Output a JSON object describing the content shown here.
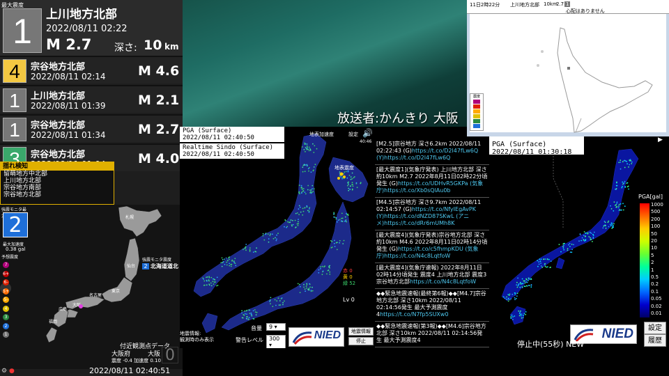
{
  "main_quake": {
    "header": "最大震度",
    "intensity": "1",
    "region": "上川地方北部",
    "time": "2022/08/11  02:22",
    "magnitude": "M 2.7",
    "depth_label": "深さ:",
    "depth_value": "10",
    "depth_unit": "km"
  },
  "history": [
    {
      "intensity": "4",
      "region": "宗谷地方北部",
      "time": "2022/08/11  02:14",
      "magnitude": "M 4.6",
      "color": "#f3c842",
      "text_color": "#000"
    },
    {
      "intensity": "1",
      "region": "上川地方北部",
      "time": "2022/08/11  01:39",
      "magnitude": "M 2.1",
      "color": "#777777",
      "text_color": "#fff"
    },
    {
      "intensity": "1",
      "region": "宗谷地方北部",
      "time": "2022/08/11  01:34",
      "magnitude": "M 2.7",
      "color": "#777777",
      "text_color": "#fff"
    },
    {
      "intensity": "3",
      "region": "宗谷地方北部",
      "time": "2022/08/11  01:04",
      "magnitude": "M 4.0",
      "color": "#3aa86b",
      "text_color": "#fff"
    }
  ],
  "shake_detect": {
    "title": "揺れ検知",
    "regions": [
      "留萌地方中北部",
      "上川地方北部",
      "宗谷地方南部",
      "宗谷地方北部"
    ]
  },
  "kmoni": {
    "max_int_label": "強震モニタ最大震度",
    "max_int_value": "2",
    "pga_label": "最大加速度",
    "pga_value": "0.38 gal",
    "pred_label": "予想震度",
    "scale": [
      "7",
      "6+",
      "6-",
      "5+",
      "5-",
      "4",
      "3",
      "2",
      "1"
    ],
    "scale_colors": [
      "#b0007a",
      "#c00000",
      "#e02000",
      "#ff6a00",
      "#ffaa00",
      "#e0c000",
      "#2a8a40",
      "#1e6fd9",
      "#777777"
    ],
    "monitor_badge_title": "強震モニタ震度",
    "monitor_badge_num": "2",
    "monitor_badge_place": "北海道道北",
    "nearest_label": "付近観測点データ",
    "nearest_pref": "大阪府",
    "nearest_name": "大阪",
    "nearest_values": "震度 -0.4  加速度 0.10",
    "nearest_big": "0",
    "footer_time": "2022/08/11  02:40:51",
    "city_labels": [
      "札幌",
      "仙台",
      "東京",
      "名古屋",
      "大阪",
      "広島",
      "福岡"
    ]
  },
  "video": {
    "caption": "放送者:かんきり  大阪"
  },
  "top_right": {
    "bar_date": "11日2時22分",
    "bar_region": "上川地方北部",
    "bar_depth": "10km",
    "bar_mag": "2.7",
    "bar_tsunami": "心配はありません",
    "bar_icon": "1",
    "legend_title": "震度"
  },
  "center": {
    "label1": "PGA (Surface)",
    "time1": "2022/08/11 02:40:50",
    "label2": "Realtime Sindo (Surface)",
    "time2": "2022/08/11 02:40:50",
    "top_label": "地表加速度",
    "setting": "設定",
    "clock": "40:46",
    "inset_label": "地表震度",
    "red_count": "赤 0",
    "yellow_count": "黄 0",
    "green_count": "緑 52",
    "level": "Lv 0",
    "quake_info_1": "地震情報:",
    "quake_info_2": "観測時のみ表示",
    "volume_label": "音量",
    "volume_value": "9",
    "alarm_label": "警告レベル",
    "alarm_value": "300",
    "nied_text": "NIED",
    "btn_info": "地震情報",
    "btn_stop": "停止"
  },
  "feed": [
    {
      "text": "[M2.5]宗谷地方 深さ6.2km 2022/08/11 02:22:43 (G)",
      "link": "https://t.co/D2l47fLw6Q (Y)https://t.co/D2l47fLw6Q"
    },
    {
      "text": "[最大震度1](気象庁発表) 上川地方北部 深さ約10km M2.7 2022年8月11日02時22分頃発生 (G)",
      "link": "https://t.co/UDHvR5GKPa (気象庁)https://t.co/Xb0sQlAu0b"
    },
    {
      "text": "[M4.5]宗谷地方 深さ9.7km 2022/08/11 02:14:57 (G)",
      "link": "https://t.co/NfyIEgAvPK (Y)https://t.co/dNZD87SKwL (アニメ)https://t.co/dRr6mUMh8K"
    },
    {
      "text": "[最大震度4](気象庁発表)宗谷地方北部 深さ約10km M4.6 2022年8月11日02時14分頃発生 (G)",
      "link": "https://t.co/c5fhmpKDU (気象庁)https://t.co/N4c8LqtfoW"
    },
    {
      "text": "[最大震度4](気象庁速報) 2022年8月11日02時14分頃発生 震度4 上川地方北部 震度3 宗谷地方北部",
      "link": "https://t.co/N4c8LqtfoW"
    },
    {
      "text": "◆◆緊急地震速報(最終第6報)◆◆[M4.7]宗谷地方北部 深さ10km 2022/08/11 02:14:56発生 最大予測震度4",
      "link": "https://t.co/N7fp5SUXw0"
    },
    {
      "text": "◆◆緊急地震速報(第3報)◆◆[M4.6]宗谷地方北部 深さ10km 2022/08/11 02:14:56発生 最大予測震度4",
      "link": ""
    }
  ],
  "right": {
    "label": "PGA (Surface)",
    "time": "2022/08/11 01:30:18",
    "scale_title": "PGA[gal]",
    "ticks": [
      "1000",
      "500",
      "200",
      "100",
      "50",
      "20",
      "10",
      "5",
      "2",
      "1",
      "0.5",
      "0.2",
      "0.1",
      "0.05",
      "0.02",
      "0.01"
    ],
    "nied_text": "NIED",
    "btn_setting": "設定",
    "btn_history": "履歴",
    "status": "停止中(55秒) NEW"
  }
}
